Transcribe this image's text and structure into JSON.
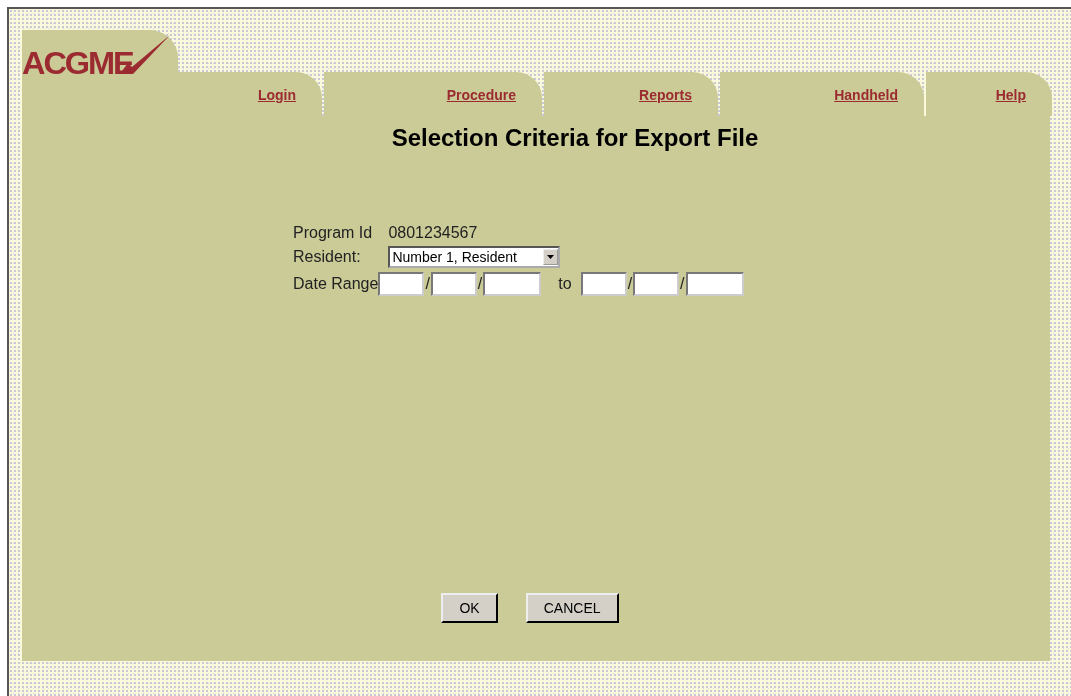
{
  "logo": {
    "text": "ACGME"
  },
  "tabs": [
    {
      "label": "Login"
    },
    {
      "label": "Procedure"
    },
    {
      "label": "Reports"
    },
    {
      "label": "Handheld"
    },
    {
      "label": "Help"
    }
  ],
  "title": "Selection Criteria for Export File",
  "form": {
    "program_id": {
      "label": "Program Id",
      "value": "0801234567"
    },
    "resident": {
      "label": "Resident:",
      "value": "Number 1, Resident"
    },
    "date_range": {
      "label": "Date Range",
      "from_separators": [
        "/",
        "/"
      ],
      "to": "to",
      "to_separators": [
        "/",
        "/"
      ]
    }
  },
  "buttons": [
    "OK",
    "CANCEL"
  ]
}
